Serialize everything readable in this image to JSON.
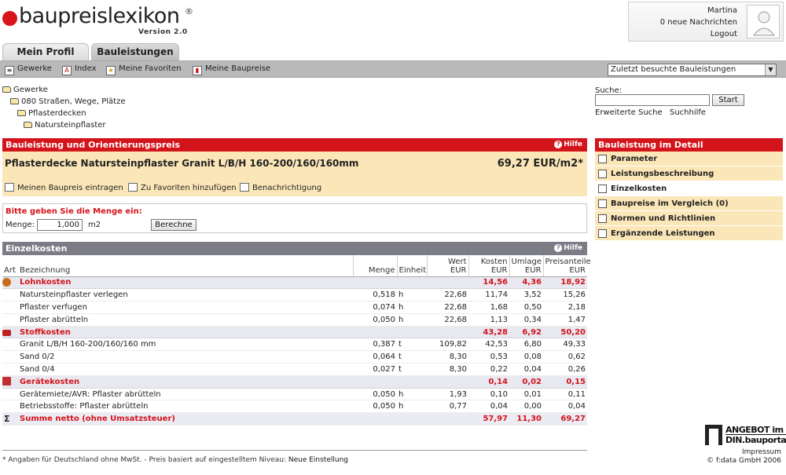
{
  "logo": {
    "name": "baupreislexikon",
    "reg": "®",
    "version": "Version 2.0"
  },
  "user": {
    "name": "Martina",
    "messages": "0 neue Nachrichten",
    "logout": "Logout"
  },
  "tabs": [
    {
      "label": "Mein Profil"
    },
    {
      "label": "Bauleistungen"
    }
  ],
  "toolbar": {
    "items": [
      {
        "label": "Gewerke",
        "icon": "list-icon"
      },
      {
        "label": "Index",
        "icon": "index-icon"
      },
      {
        "label": "Meine Favoriten",
        "icon": "star-icon"
      },
      {
        "label": "Meine Baupreise",
        "icon": "chart-icon"
      }
    ],
    "recent_select": "Zuletzt besuchte Bauleistungen"
  },
  "breadcrumb": [
    "Gewerke",
    "080 Straßen, Wege, Plätze",
    "Pflasterdecken",
    "Natursteinpflaster"
  ],
  "search": {
    "label": "Suche:",
    "button": "Start",
    "advanced": "Erweiterte Suche",
    "help": "Suchhilfe"
  },
  "bauleistung": {
    "header": "Bauleistung und Orientierungspreis",
    "hilfe": "Hilfe",
    "title": "Pflasterdecke Natursteinpflaster Granit L/B/H 160-200/160/160mm",
    "price": "69,27 EUR/m2*",
    "actions": [
      "Meinen Baupreis eintragen",
      "Zu Favoriten hinzufügen",
      "Benachrichtigung"
    ]
  },
  "menge": {
    "title": "Bitte geben Sie die Menge ein:",
    "label": "Menge:",
    "value": "1,000",
    "unit": "m2",
    "button": "Berechne"
  },
  "detail": {
    "header": "Bauleistung im Detail",
    "items": [
      {
        "label": "Parameter",
        "icon": "parameter-icon"
      },
      {
        "label": "Leistungsbeschreibung",
        "icon": "document-icon"
      },
      {
        "label": "Einzelkosten",
        "icon": "calculator-icon"
      },
      {
        "label": "Baupreise im Vergleich  (0)",
        "icon": "chart-icon"
      },
      {
        "label": "Normen und Richtlinien",
        "icon": "din-icon"
      },
      {
        "label": "Ergänzende Leistungen",
        "icon": "addon-icon"
      }
    ]
  },
  "einzelkosten": {
    "header": "Einzelkosten",
    "hilfe": "Hilfe",
    "columns": {
      "art": "Art",
      "bez": "Bezeichnung",
      "menge": "Menge",
      "einheit": "Einheit",
      "wert": "Wert",
      "kosten": "Kosten",
      "umlage": "Umlage",
      "preisanteile": "Preisanteile",
      "eur": "EUR"
    },
    "rows": [
      {
        "type": "cat",
        "icon": "clock-icon",
        "bez": "Lohnkosten",
        "menge": "",
        "einheit": "",
        "wert": "",
        "kosten": "14,56",
        "umlage": "4,36",
        "preis": "18,92"
      },
      {
        "type": "item",
        "bez": "Natursteinpflaster verlegen",
        "menge": "0,518",
        "einheit": "h",
        "wert": "22,68",
        "kosten": "11,74",
        "umlage": "3,52",
        "preis": "15,26"
      },
      {
        "type": "item",
        "bez": "Pflaster verfugen",
        "menge": "0,074",
        "einheit": "h",
        "wert": "22,68",
        "kosten": "1,68",
        "umlage": "0,50",
        "preis": "2,18"
      },
      {
        "type": "item",
        "bez": "Pflaster abrütteln",
        "menge": "0,050",
        "einheit": "h",
        "wert": "22,68",
        "kosten": "1,13",
        "umlage": "0,34",
        "preis": "1,47"
      },
      {
        "type": "cat",
        "icon": "truck-icon",
        "bez": "Stoffkosten",
        "menge": "",
        "einheit": "",
        "wert": "",
        "kosten": "43,28",
        "umlage": "6,92",
        "preis": "50,20"
      },
      {
        "type": "item",
        "bez": "Granit L/B/H 160-200/160/160 mm",
        "menge": "0,387",
        "einheit": "t",
        "wert": "109,82",
        "kosten": "42,53",
        "umlage": "6,80",
        "preis": "49,33"
      },
      {
        "type": "item",
        "bez": "Sand 0/2",
        "menge": "0,064",
        "einheit": "t",
        "wert": "8,30",
        "kosten": "0,53",
        "umlage": "0,08",
        "preis": "0,62"
      },
      {
        "type": "item",
        "bez": "Sand 0/4",
        "menge": "0,027",
        "einheit": "t",
        "wert": "8,30",
        "kosten": "0,22",
        "umlage": "0,04",
        "preis": "0,26"
      },
      {
        "type": "cat",
        "icon": "machine-icon",
        "bez": "Gerätekosten",
        "menge": "",
        "einheit": "",
        "wert": "",
        "kosten": "0,14",
        "umlage": "0,02",
        "preis": "0,15"
      },
      {
        "type": "item",
        "bez": "Gerätemiete/AVR: Pflaster abrütteln",
        "menge": "0,050",
        "einheit": "h",
        "wert": "1,93",
        "kosten": "0,10",
        "umlage": "0,01",
        "preis": "0,11"
      },
      {
        "type": "item",
        "bez": "Betriebsstoffe: Pflaster abrütteln",
        "menge": "0,050",
        "einheit": "h",
        "wert": "0,77",
        "kosten": "0,04",
        "umlage": "0,00",
        "preis": "0,04"
      },
      {
        "type": "sum",
        "icon": "sigma-icon",
        "symbol": "Σ",
        "bez": "Summe netto (ohne Umsatzsteuer)",
        "menge": "",
        "einheit": "",
        "wert": "",
        "kosten": "57,97",
        "umlage": "11,30",
        "preis": "69,27"
      }
    ]
  },
  "footer": {
    "note": "* Angaben für Deutschland ohne MwSt. - Preis basiert auf eingestelltem Niveau:",
    "note_link": "Neue Einstellung",
    "angebot_1": "ANGEBOT im",
    "angebot_2": "DIN.bauportal",
    "impressum": "Impressum",
    "copyright": "© f:data GmbH 2006"
  },
  "colors": {
    "accent_red": "#d4141b",
    "panel_gray": "#7c7c86",
    "cream": "#fbe6b8"
  }
}
